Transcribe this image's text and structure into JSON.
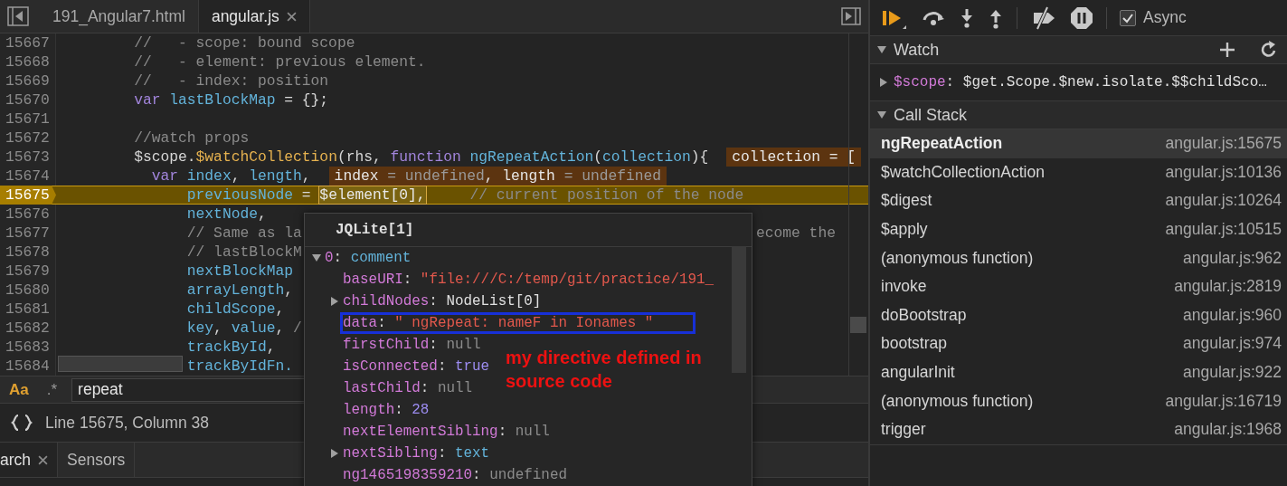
{
  "editor": {
    "tabs": [
      {
        "label": "191_Angular7.html",
        "selected": false,
        "closable": false
      },
      {
        "label": "angular.js",
        "selected": true,
        "closable": true
      }
    ],
    "lines": [
      {
        "number": "15667",
        "paused": false,
        "tokens": [
          {
            "kind": "comment",
            "text": "        //   - scope: bound scope"
          }
        ]
      },
      {
        "number": "15668",
        "paused": false,
        "tokens": [
          {
            "kind": "comment",
            "text": "        //   - element: previous element."
          }
        ]
      },
      {
        "number": "15669",
        "paused": false,
        "tokens": [
          {
            "kind": "comment",
            "text": "        //   - index: position"
          }
        ]
      },
      {
        "number": "15670",
        "paused": false,
        "tokens": [
          {
            "kind": "keyword",
            "text": "        var"
          },
          {
            "kind": "ident",
            "text": " lastBlockMap"
          },
          {
            "kind": "plain",
            "text": " = {};"
          }
        ]
      },
      {
        "number": "15671",
        "paused": false
      },
      {
        "number": "15672",
        "paused": false,
        "tokens": [
          {
            "kind": "comment",
            "text": "        //watch props"
          }
        ]
      },
      {
        "number": "15673",
        "paused": false,
        "tokens": [
          {
            "kind": "plain",
            "text": "        $scope."
          },
          {
            "kind": "method",
            "text": "$watchCollection"
          },
          {
            "kind": "plain",
            "text": "(rhs, "
          },
          {
            "kind": "keyword",
            "text": "function"
          },
          {
            "kind": "ident",
            "text": " ngRepeatAction"
          },
          {
            "kind": "plain",
            "text": "("
          },
          {
            "kind": "ident",
            "text": "collection"
          },
          {
            "kind": "plain",
            "text": "){"
          }
        ],
        "inline": [
          {
            "kind": "name",
            "text": "collection"
          },
          {
            "kind": "name",
            "text": " = ["
          }
        ]
      },
      {
        "number": "15674",
        "paused": false,
        "tokens": [
          {
            "kind": "keyword",
            "text": "          var"
          },
          {
            "kind": "ident",
            "text": " index"
          },
          {
            "kind": "plain",
            "text": ", "
          },
          {
            "kind": "ident",
            "text": "length"
          },
          {
            "kind": "plain",
            "text": ","
          }
        ],
        "inline": [
          {
            "kind": "name",
            "text": "index"
          },
          {
            "kind": "muted",
            "text": " = undefined"
          },
          {
            "kind": "name",
            "text": ", length"
          },
          {
            "kind": "muted",
            "text": " = undefined"
          }
        ]
      },
      {
        "number": "15675",
        "paused": true,
        "tokens": [
          {
            "kind": "ident",
            "text": "              previousNode"
          },
          {
            "kind": "plain",
            "text": " = "
          },
          {
            "kind": "boxed",
            "text": "$element[0],"
          },
          {
            "kind": "comment",
            "text": "     // current position of the node"
          }
        ]
      },
      {
        "number": "15676",
        "paused": false,
        "tokens": [
          {
            "kind": "ident",
            "text": "              nextNode"
          },
          {
            "kind": "plain",
            "text": ","
          }
        ]
      },
      {
        "number": "15677",
        "paused": false,
        "tokens": [
          {
            "kind": "comment",
            "text": "              // Same as la"
          }
        ],
        "after_popup": "ecome the"
      },
      {
        "number": "15678",
        "paused": false,
        "tokens": [
          {
            "kind": "comment",
            "text": "              // lastBlockM"
          }
        ]
      },
      {
        "number": "15679",
        "paused": false,
        "tokens": [
          {
            "kind": "ident",
            "text": "              nextBlockMap"
          }
        ]
      },
      {
        "number": "15680",
        "paused": false,
        "tokens": [
          {
            "kind": "ident",
            "text": "              arrayLength"
          },
          {
            "kind": "plain",
            "text": ","
          }
        ]
      },
      {
        "number": "15681",
        "paused": false,
        "tokens": [
          {
            "kind": "ident",
            "text": "              childScope"
          },
          {
            "kind": "plain",
            "text": ","
          }
        ]
      },
      {
        "number": "15682",
        "paused": false,
        "tokens": [
          {
            "kind": "ident",
            "text": "              key"
          },
          {
            "kind": "plain",
            "text": ", "
          },
          {
            "kind": "ident",
            "text": "value"
          },
          {
            "kind": "plain",
            "text": ", "
          },
          {
            "kind": "comment",
            "text": "/"
          }
        ]
      },
      {
        "number": "15683",
        "paused": false,
        "tokens": [
          {
            "kind": "ident",
            "text": "              trackById"
          },
          {
            "kind": "plain",
            "text": ","
          }
        ]
      },
      {
        "number": "15684",
        "paused": false,
        "tokens": [
          {
            "kind": "ident",
            "text": "              trackByIdFn."
          }
        ]
      }
    ],
    "search": {
      "toggles": [
        {
          "label": "Aa",
          "on": true
        },
        {
          "label": ".*",
          "on": false
        }
      ],
      "value": "repeat"
    },
    "status": "Line 15675, Column 38"
  },
  "drawer": {
    "tabs": [
      {
        "label": "arch",
        "selected": true,
        "closable": true
      },
      {
        "label": "Sensors",
        "selected": false,
        "closable": false
      }
    ]
  },
  "popover": {
    "title": "JQLite[1]",
    "root": {
      "key": "0",
      "separator": ": ",
      "value": "comment",
      "kind": "node",
      "expanded": true
    },
    "properties": [
      {
        "key": "baseURI",
        "separator": ": ",
        "value": "\"file:///C:/temp/git/practice/191_",
        "kind": "string"
      },
      {
        "key": "childNodes",
        "separator": ": ",
        "value": "NodeList[0]",
        "kind": "object",
        "expanded": false
      },
      {
        "key": "data",
        "separator": ": ",
        "value": "\" ngRepeat: nameF in Ionames \"",
        "kind": "string",
        "annotated": true
      },
      {
        "key": "firstChild",
        "separator": ": ",
        "value": "null",
        "kind": "null"
      },
      {
        "key": "isConnected",
        "separator": ": ",
        "value": "true",
        "kind": "boolean"
      },
      {
        "key": "lastChild",
        "separator": ": ",
        "value": "null",
        "kind": "null"
      },
      {
        "key": "length",
        "separator": ": ",
        "value": "28",
        "kind": "number"
      },
      {
        "key": "nextElementSibling",
        "separator": ": ",
        "value": "null",
        "kind": "null"
      },
      {
        "key": "nextSibling",
        "separator": ": ",
        "value": "text",
        "kind": "node",
        "expanded": false
      },
      {
        "key": "ng1465198359210",
        "separator": ": ",
        "value": "undefined",
        "kind": "null"
      }
    ],
    "annotation": "my directive defined in source code"
  },
  "debugger": {
    "async": {
      "label": "Async",
      "checked": true
    },
    "watch": {
      "title": "Watch",
      "expanded": true,
      "items": [
        {
          "key": "$scope",
          "separator": ": ",
          "value": "$get.Scope.$new.isolate.$$childSco…",
          "expanded": false
        }
      ]
    },
    "call_stack": {
      "title": "Call Stack",
      "expanded": true,
      "frames": [
        {
          "name": "ngRepeatAction",
          "location": "angular.js:15675",
          "selected": true
        },
        {
          "name": "$watchCollectionAction",
          "location": "angular.js:10136",
          "selected": false
        },
        {
          "name": "$digest",
          "location": "angular.js:10264",
          "selected": false
        },
        {
          "name": "$apply",
          "location": "angular.js:10515",
          "selected": false
        },
        {
          "name": "(anonymous function)",
          "location": "angular.js:962",
          "selected": false
        },
        {
          "name": "invoke",
          "location": "angular.js:2819",
          "selected": false
        },
        {
          "name": "doBootstrap",
          "location": "angular.js:960",
          "selected": false
        },
        {
          "name": "bootstrap",
          "location": "angular.js:974",
          "selected": false
        },
        {
          "name": "angularInit",
          "location": "angular.js:922",
          "selected": false
        },
        {
          "name": "(anonymous function)",
          "location": "angular.js:16719",
          "selected": false
        },
        {
          "name": "trigger",
          "location": "angular.js:1968",
          "selected": false
        }
      ]
    }
  }
}
